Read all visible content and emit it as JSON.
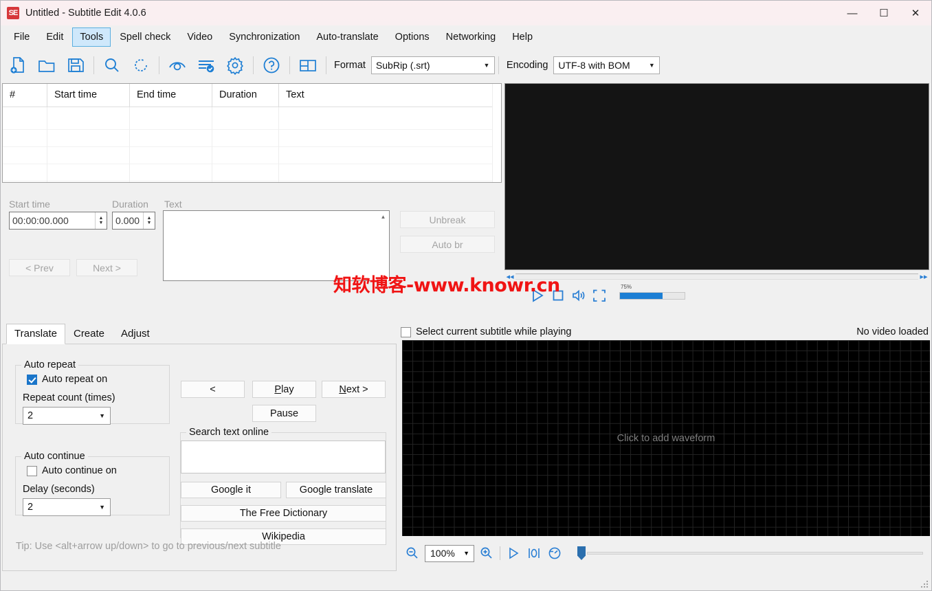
{
  "window": {
    "title": "Untitled - Subtitle Edit 4.0.6",
    "icon_name": "subtitle-edit-logo",
    "icon_text": "SE",
    "minimize": "—",
    "maximize": "☐",
    "close": "✕"
  },
  "menu": {
    "items": [
      {
        "label": "File",
        "active": false
      },
      {
        "label": "Edit",
        "active": false
      },
      {
        "label": "Tools",
        "active": true
      },
      {
        "label": "Spell check",
        "active": false
      },
      {
        "label": "Video",
        "active": false
      },
      {
        "label": "Synchronization",
        "active": false
      },
      {
        "label": "Auto-translate",
        "active": false
      },
      {
        "label": "Options",
        "active": false
      },
      {
        "label": "Networking",
        "active": false
      },
      {
        "label": "Help",
        "active": false
      }
    ]
  },
  "toolbar": {
    "buttons": [
      "new-file-icon",
      "open-folder-icon",
      "save-icon",
      "search-icon",
      "replace-sync-icon",
      "visual-sync-icon",
      "spell-check-icon",
      "settings-gear-icon",
      "help-icon",
      "layout-icon"
    ],
    "format_label": "Format",
    "format_value": "SubRip (.srt)",
    "encoding_label": "Encoding",
    "encoding_value": "UTF-8 with BOM"
  },
  "grid": {
    "columns": [
      "#",
      "Start time",
      "End time",
      "Duration",
      "Text"
    ],
    "rows": []
  },
  "edit_panel": {
    "start_time_label": "Start time",
    "start_time_value": "00:00:00.000",
    "duration_label": "Duration",
    "duration_value": "0.000",
    "text_label": "Text",
    "text_value": "",
    "prev_button": "< Prev",
    "next_button": "Next >",
    "unbreak_button": "Unbreak",
    "autobr_button": "Auto br"
  },
  "video": {
    "play_icon": "play-icon",
    "stop_icon": "stop-icon",
    "volume_icon": "speaker-icon",
    "fullscreen_icon": "fullscreen-icon",
    "volume_percent": "75%",
    "volume_fill": 66,
    "seek_back_icon": "rewind-icon",
    "seek_fwd_icon": "fast-forward-icon"
  },
  "tabs": {
    "items": [
      {
        "label": "Translate",
        "selected": true
      },
      {
        "label": "Create",
        "selected": false
      },
      {
        "label": "Adjust",
        "selected": false
      }
    ]
  },
  "translate_tab": {
    "auto_repeat": {
      "title": "Auto repeat",
      "checkbox_label": "Auto repeat on",
      "checked": true,
      "count_label": "Repeat count (times)",
      "count_value": "2"
    },
    "auto_continue": {
      "title": "Auto continue",
      "checkbox_label": "Auto continue on",
      "checked": false,
      "delay_label": "Delay (seconds)",
      "delay_value": "2"
    },
    "playback": {
      "prev_button": "<",
      "play_button": "Play",
      "next_button": "Next >",
      "pause_button": "Pause"
    },
    "search": {
      "title": "Search text online",
      "input_value": "",
      "google_it": "Google it",
      "google_translate": "Google translate",
      "free_dictionary": "The Free Dictionary",
      "wikipedia": "Wikipedia"
    },
    "tip": "Tip: Use <alt+arrow up/down> to go to previous/next subtitle"
  },
  "waveform": {
    "select_checkbox_label": "Select current subtitle while playing",
    "select_checked": false,
    "status": "No video loaded",
    "hint": "Click to add waveform",
    "zoom_out_icon": "zoom-out-icon",
    "zoom_in_icon": "zoom-in-icon",
    "zoom_value": "100%",
    "play_icon": "play-icon",
    "marker_icon": "zero-marker-icon",
    "speed_icon": "playback-speed-icon"
  },
  "watermark": {
    "text": "知软博客-www.knowr.cn",
    "color": "#f01414"
  },
  "colors": {
    "accent_blue": "#1a75c9",
    "icon_blue": "#2a7fd4",
    "menu_highlight": "#cfe8fb",
    "window_bg": "#f0f0f0",
    "titlebar_bg": "#fbeff1",
    "video_bg": "#141414"
  }
}
